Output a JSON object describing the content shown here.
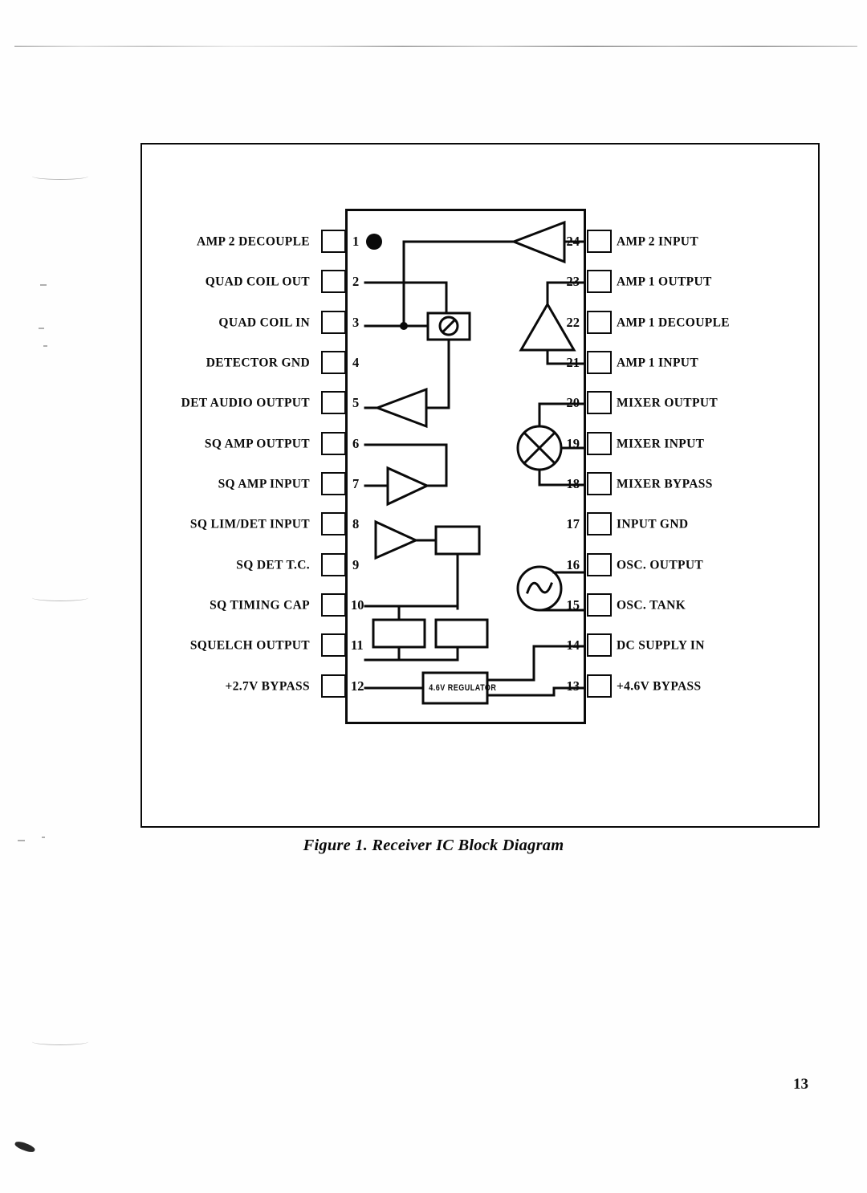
{
  "document": {
    "page_number": "13",
    "figure_caption": "Figure 1. Receiver IC Block Diagram"
  },
  "diagram": {
    "type": "ic-block-diagram",
    "package": "24-pin DIP",
    "pin_count": 24,
    "orientation_marker": "dot at pin 1",
    "left_pins": [
      {
        "number": "1",
        "label": "AMP 2 DECOUPLE"
      },
      {
        "number": "2",
        "label": "QUAD COIL OUT"
      },
      {
        "number": "3",
        "label": "QUAD COIL IN"
      },
      {
        "number": "4",
        "label": "DETECTOR GND"
      },
      {
        "number": "5",
        "label": "DET AUDIO OUTPUT"
      },
      {
        "number": "6",
        "label": "SQ AMP OUTPUT"
      },
      {
        "number": "7",
        "label": "SQ AMP INPUT"
      },
      {
        "number": "8",
        "label": "SQ LIM/DET INPUT"
      },
      {
        "number": "9",
        "label": "SQ DET T.C."
      },
      {
        "number": "10",
        "label": "SQ TIMING CAP"
      },
      {
        "number": "11",
        "label": "SQUELCH OUTPUT"
      },
      {
        "number": "12",
        "label": "+2.7V BYPASS"
      }
    ],
    "right_pins": [
      {
        "number": "24",
        "label": "AMP 2 INPUT"
      },
      {
        "number": "23",
        "label": "AMP 1 OUTPUT"
      },
      {
        "number": "22",
        "label": "AMP 1 DECOUPLE"
      },
      {
        "number": "21",
        "label": "AMP 1 INPUT"
      },
      {
        "number": "20",
        "label": "MIXER OUTPUT"
      },
      {
        "number": "19",
        "label": "MIXER INPUT"
      },
      {
        "number": "18",
        "label": "MIXER BYPASS"
      },
      {
        "number": "17",
        "label": "INPUT GND"
      },
      {
        "number": "16",
        "label": "OSC. OUTPUT"
      },
      {
        "number": "15",
        "label": "OSC. TANK"
      },
      {
        "number": "14",
        "label": "DC SUPPLY IN"
      },
      {
        "number": "13",
        "label": "+4.6V BYPASS"
      }
    ],
    "blocks": [
      {
        "name": "regulator",
        "label": "4.6V REGULATOR"
      },
      {
        "name": "quad-detector",
        "label": ""
      },
      {
        "name": "squelch-detector",
        "label": ""
      },
      {
        "name": "squelch-gate-left",
        "label": ""
      },
      {
        "name": "squelch-gate-right",
        "label": ""
      }
    ],
    "symbols": [
      {
        "name": "amp-2",
        "type": "triangle-amplifier"
      },
      {
        "name": "amp-1",
        "type": "triangle-amplifier"
      },
      {
        "name": "det-audio-amp",
        "type": "triangle-amplifier"
      },
      {
        "name": "sq-amp",
        "type": "triangle-amplifier"
      },
      {
        "name": "sq-lim-amp",
        "type": "triangle-amplifier"
      },
      {
        "name": "mixer",
        "type": "circle-cross"
      },
      {
        "name": "oscillator",
        "type": "circle-sine"
      },
      {
        "name": "quad-detector",
        "type": "circle-slash-box"
      }
    ],
    "colors": {
      "ink": "#0a0a0a",
      "paper": "#ffffff"
    }
  }
}
